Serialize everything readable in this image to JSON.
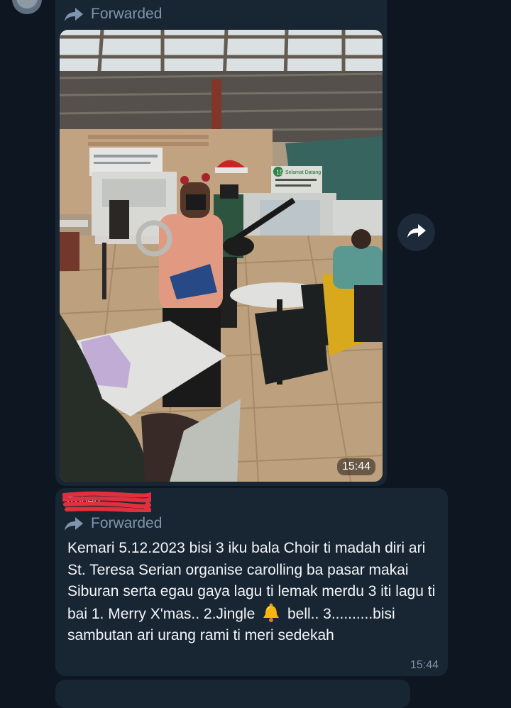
{
  "chat": {
    "messages": [
      {
        "forwarded_label": "Forwarded",
        "time": "15:44",
        "media": "photo",
        "photo_signs": {
          "stall_banner": "Selamat Datang",
          "stall_number": "15"
        }
      },
      {
        "sender_name": "Robert",
        "forwarded_label": "Forwarded",
        "text_part1": "Kemari 5.12.2023 bisi 3 iku bala Choir ti madah diri ari St. Teresa Serian organise carolling ba pasar makai Siburan serta egau gaya lagu ti lemak merdu 3 iti lagu ti bai 1. Merry X'mas.. 2.Jingle",
        "emoji": "bell",
        "text_part2": "bell.. 3..........bisi sambutan ari urang rami ti meri sedekah",
        "time": "15:44"
      }
    ]
  },
  "colors": {
    "background": "#0e1621",
    "bubble": "#182533",
    "forwarded_text": "#7f95ab",
    "message_text": "#f4f6f8",
    "time_text": "#8094a8",
    "redaction": "#e0303d"
  },
  "icons": {
    "forward": "forward-arrow-icon",
    "share": "share-arrow-icon",
    "emoji": "bell-emoji-icon"
  }
}
